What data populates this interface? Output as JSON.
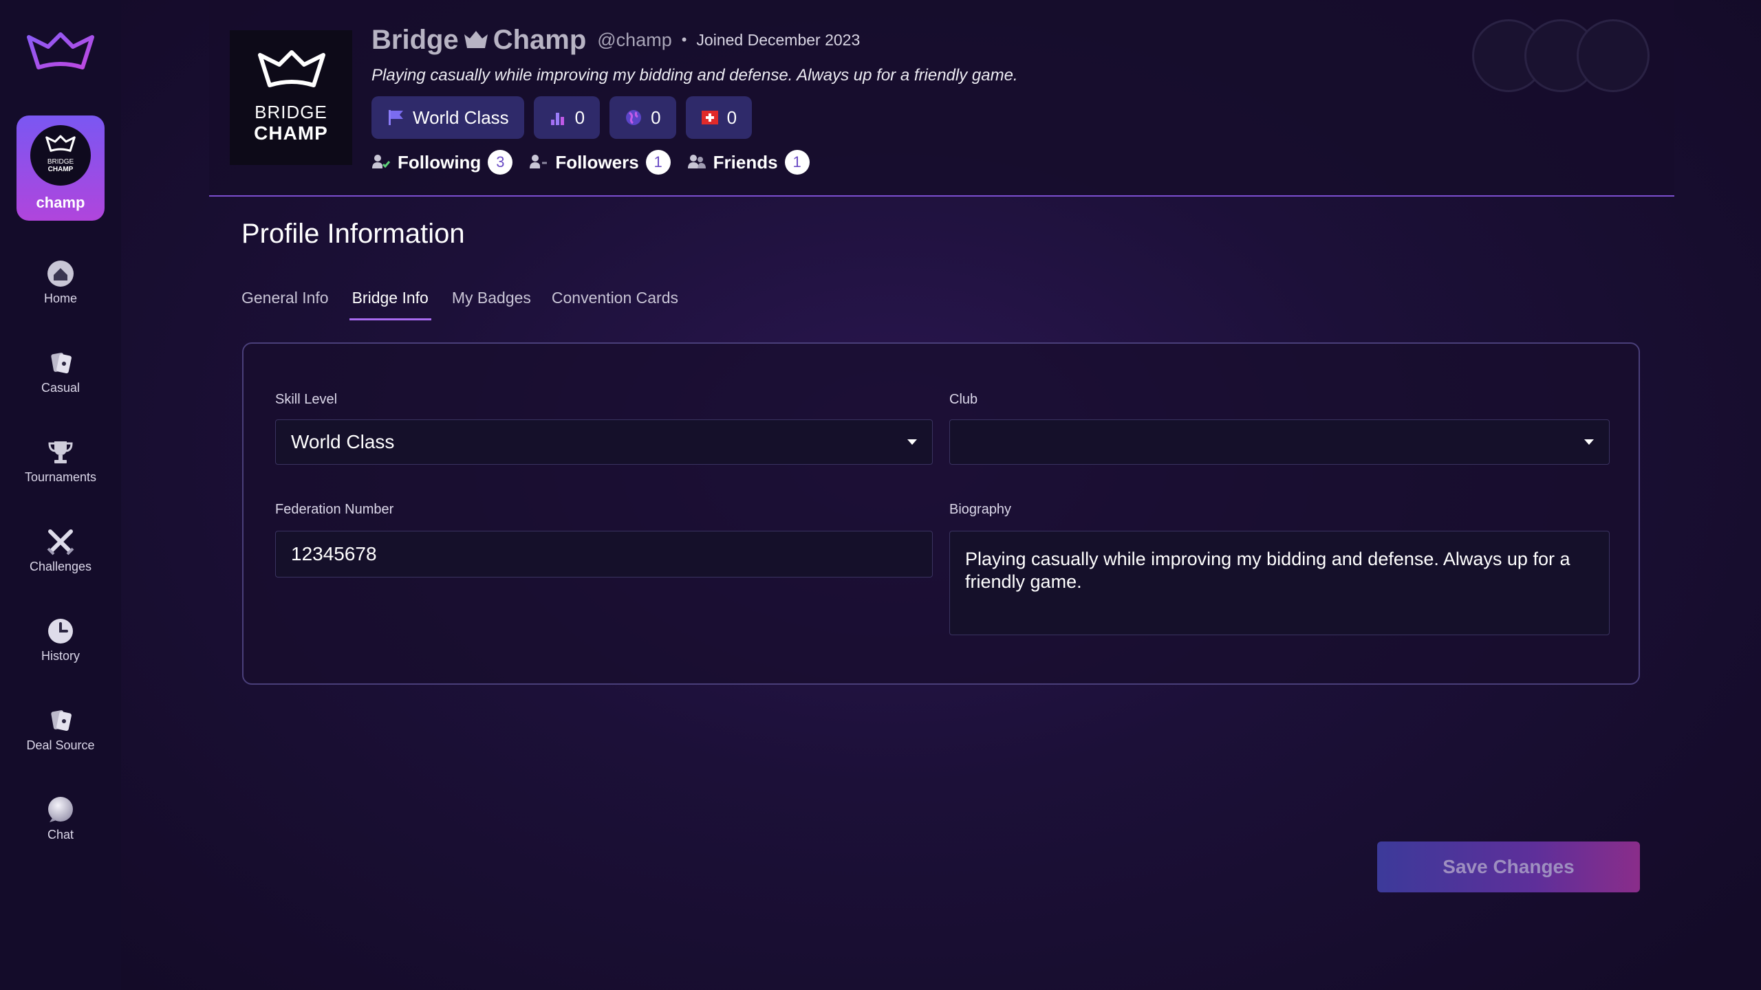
{
  "sidebar": {
    "logo_icon": "crown-icon",
    "user": {
      "avatar_line1": "BRIDGE",
      "avatar_line2": "CHAMP",
      "name": "champ"
    },
    "nav": [
      {
        "label": "Home",
        "icon": "home-icon"
      },
      {
        "label": "Casual",
        "icon": "cards-icon"
      },
      {
        "label": "Tournaments",
        "icon": "trophy-icon"
      },
      {
        "label": "Challenges",
        "icon": "crossed-swords-icon"
      },
      {
        "label": "History",
        "icon": "clock-icon"
      },
      {
        "label": "Deal Source",
        "icon": "cards-icon"
      },
      {
        "label": "Chat",
        "icon": "chat-bubble-icon"
      }
    ]
  },
  "profile": {
    "logo_line1": "BRIDGE",
    "logo_line2": "CHAMP",
    "name_first": "Bridge",
    "name_second": "Champ",
    "handle": "@champ",
    "separator": "•",
    "joined": "Joined December 2023",
    "bio": "Playing casually while improving my bidding and defense. Always up for a friendly game.",
    "chips": [
      {
        "label": "World Class",
        "icon": "flag-icon"
      },
      {
        "label": "0",
        "icon": "ranking-icon"
      },
      {
        "label": "0",
        "icon": "globe-icon"
      },
      {
        "label": "0",
        "icon": "swiss-flag-icon"
      }
    ],
    "social": [
      {
        "label": "Following",
        "count": "3",
        "icon": "user-check-icon"
      },
      {
        "label": "Followers",
        "count": "1",
        "icon": "user-follow-icon"
      },
      {
        "label": "Friends",
        "count": "1",
        "icon": "users-icon"
      }
    ]
  },
  "main": {
    "title": "Profile Information",
    "tabs": [
      "General Info",
      "Bridge Info",
      "My Badges",
      "Convention Cards"
    ],
    "active_tab": "Bridge Info",
    "form": {
      "skill_level_label": "Skill Level",
      "skill_level_value": "World Class",
      "club_label": "Club",
      "club_value": "",
      "federation_label": "Federation Number",
      "federation_value": "12345678",
      "biography_label": "Biography",
      "biography_value": "Playing casually while improving my bidding and defense. Always up for a friendly game."
    },
    "save_label": "Save Changes"
  },
  "colors": {
    "accent": "#a86bf0",
    "chip_bg": "#2f2a6a",
    "badge_text": "#6a4bc4"
  }
}
